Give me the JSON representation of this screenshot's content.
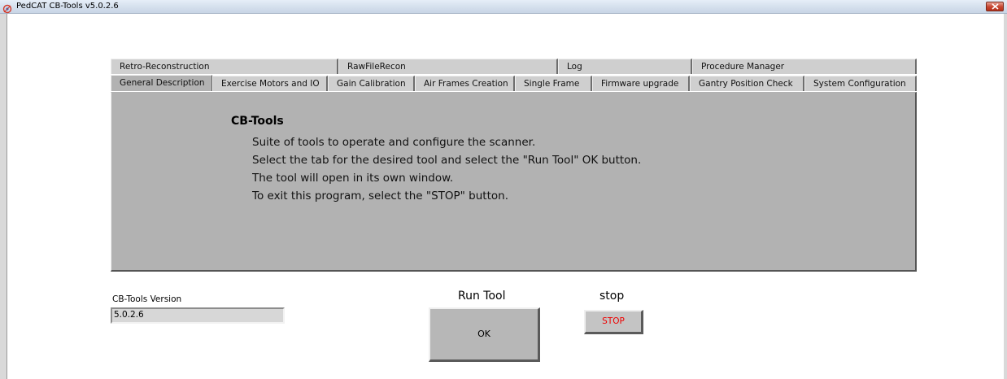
{
  "window": {
    "title": "PedCAT CB-Tools v5.0.2.6",
    "app_icon": "app-icon",
    "close_icon": "close-icon"
  },
  "tabs": {
    "row1": [
      {
        "label": "Retro-Reconstruction"
      },
      {
        "label": "RawFileRecon"
      },
      {
        "label": "Log"
      },
      {
        "label": "Procedure Manager"
      }
    ],
    "row2": [
      {
        "label": "General Description",
        "active": true
      },
      {
        "label": "Exercise Motors and IO"
      },
      {
        "label": "Gain Calibration"
      },
      {
        "label": "Air Frames Creation"
      },
      {
        "label": "Single Frame"
      },
      {
        "label": "Firmware upgrade"
      },
      {
        "label": "Gantry Position Check"
      },
      {
        "label": "System Configuration"
      }
    ]
  },
  "description": {
    "heading": "CB-Tools",
    "lines": [
      "Suite of tools to operate and configure the scanner.",
      "Select the tab for the desired tool and select the \"Run Tool\" OK button.",
      "The tool will open in its own window.",
      "To exit this program, select the \"STOP\" button."
    ]
  },
  "version": {
    "label": "CB-Tools Version",
    "value": "5.0.2.6"
  },
  "run_tool": {
    "label": "Run Tool",
    "button": "OK"
  },
  "stop": {
    "label": "stop",
    "button": "STOP",
    "button_color": "#ee0000"
  },
  "colors": {
    "panel_bg": "#b2b2b2",
    "tab_bg": "#cfcfcf",
    "window_bg": "#ffffff"
  }
}
